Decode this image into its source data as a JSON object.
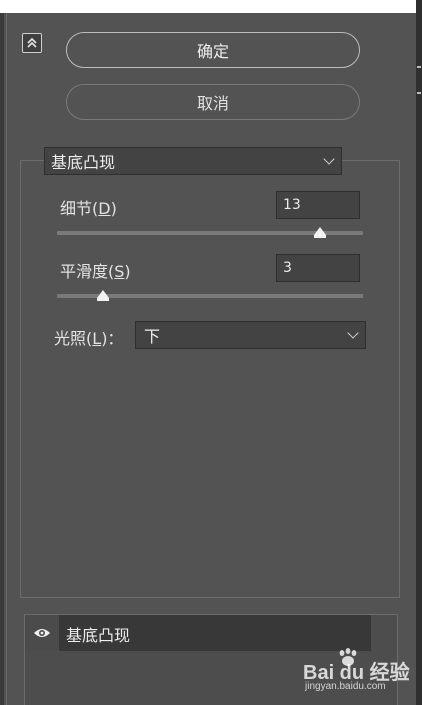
{
  "dialog": {
    "ok_label": "确定",
    "cancel_label": "取消"
  },
  "filter": {
    "selected": "基底凸现",
    "params": [
      {
        "label": "细节",
        "key": "D",
        "value": "13",
        "level": 0.86
      },
      {
        "label": "平滑度",
        "key": "S",
        "value": "3",
        "level": 0.15
      }
    ],
    "lighting": {
      "label": "光照",
      "key": "L",
      "suffix": ")：",
      "selected": "下"
    }
  },
  "layers": {
    "items": [
      {
        "name": "基底凸现",
        "visible": true
      }
    ]
  },
  "watermark": {
    "logo_text": "Bai du 经验",
    "url": "jingyan.baidu.com"
  },
  "icons": {
    "collapse": "chevron-double-up-icon",
    "eye": "eye-icon",
    "paw": "paw-icon",
    "dropdown": "chevron-down-icon"
  },
  "colors": {
    "panel_bg": "#535353",
    "field_bg": "#434343",
    "layer_row_bg": "#383838"
  }
}
